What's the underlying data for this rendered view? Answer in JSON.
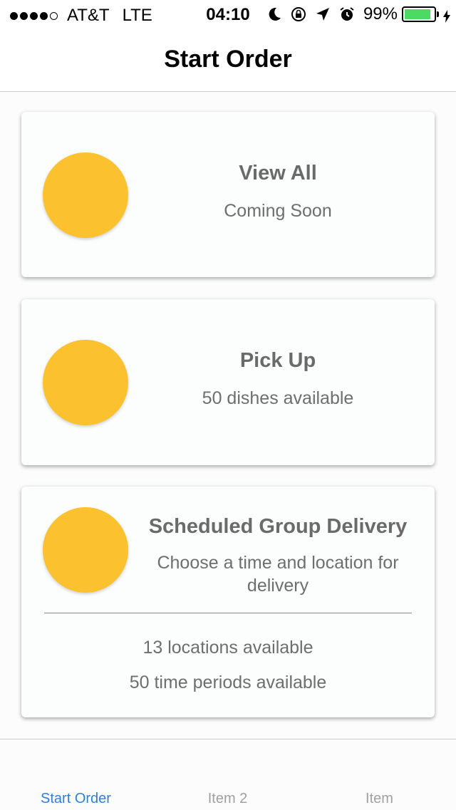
{
  "status_bar": {
    "carrier": "AT&T",
    "network": "LTE",
    "time": "04:10",
    "battery_percent": "99%",
    "battery_level": 0.99,
    "battery_color": "#4cd964",
    "icons": [
      "moon-icon",
      "rotation-lock-icon",
      "location-arrow-icon",
      "alarm-icon",
      "charging-bolt-icon"
    ]
  },
  "nav": {
    "title": "Start Order"
  },
  "cards": [
    {
      "title": "View All",
      "subtitle": "Coming Soon"
    },
    {
      "title": "Pick Up",
      "subtitle": "50 dishes available"
    },
    {
      "title": "Scheduled Group Delivery",
      "subtitle_line1": "Choose a time and location for",
      "subtitle_line2": "delivery",
      "stat_locations": "13 locations available",
      "stat_times": "50 time periods available"
    }
  ],
  "tabs": [
    {
      "label": "Start Order",
      "active": true
    },
    {
      "label": "Item 2",
      "active": false
    },
    {
      "label": "Item",
      "active": false
    }
  ],
  "colors": {
    "accent": "#2f7fd8",
    "icon_circle": "#fcc12f"
  }
}
